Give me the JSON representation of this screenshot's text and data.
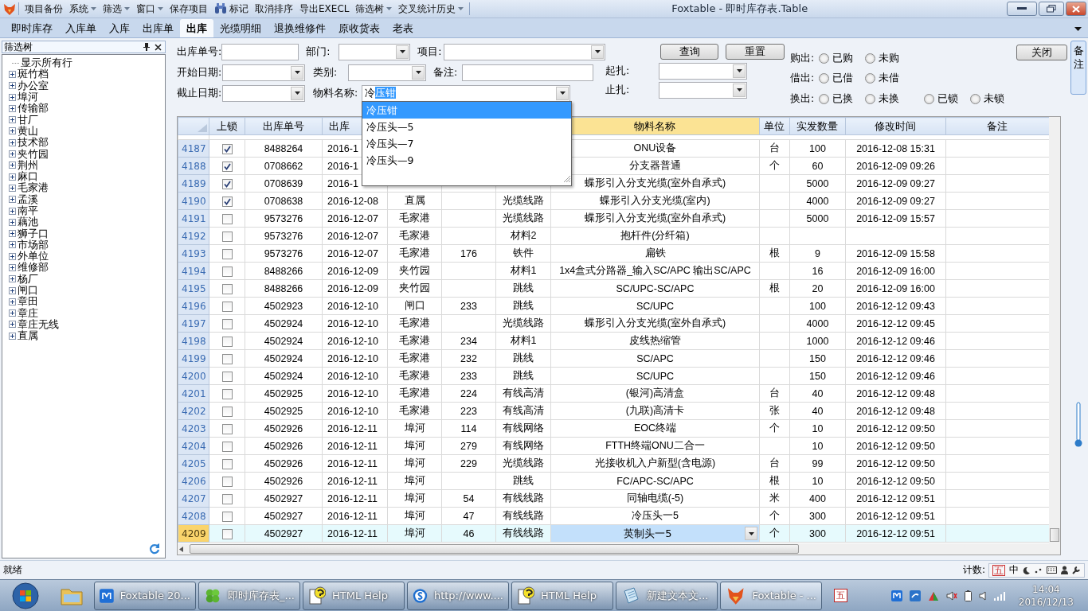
{
  "titlebar": {
    "menu": [
      {
        "label": "项目备份",
        "dropdown": false,
        "has_icon": false
      },
      {
        "label": "系统",
        "dropdown": true,
        "has_icon": false
      },
      {
        "label": "筛选",
        "dropdown": true,
        "has_icon": false
      },
      {
        "label": "窗口",
        "dropdown": true,
        "has_icon": false
      },
      {
        "label": "保存项目",
        "dropdown": false,
        "has_icon": false
      },
      {
        "label": "标记",
        "dropdown": false,
        "has_icon": true
      },
      {
        "label": "取消排序",
        "dropdown": false,
        "has_icon": false
      },
      {
        "label": "导出EXECL",
        "dropdown": false,
        "has_icon": false
      },
      {
        "label": "筛选树",
        "dropdown": true,
        "has_icon": false
      },
      {
        "label": "交叉统计历史",
        "dropdown": true,
        "has_icon": false
      }
    ],
    "title": "Foxtable - 即时库存表.Table"
  },
  "tabs": [
    {
      "label": "即时库存",
      "selected": false
    },
    {
      "label": "入库单",
      "selected": false
    },
    {
      "label": "入库",
      "selected": false
    },
    {
      "label": "出库单",
      "selected": false
    },
    {
      "label": "出库",
      "selected": true
    },
    {
      "label": "光缆明细",
      "selected": false
    },
    {
      "label": "退换维修件",
      "selected": false
    },
    {
      "label": "原收货表",
      "selected": false
    },
    {
      "label": "老表",
      "selected": false
    }
  ],
  "filter_tree": {
    "title": "筛选树",
    "items": [
      {
        "label": "显示所有行",
        "kind": "leaf"
      },
      {
        "label": "斑竹档",
        "kind": "node",
        "expanded": false
      },
      {
        "label": "办公室",
        "kind": "node",
        "expanded": false
      },
      {
        "label": "埠河",
        "kind": "node",
        "expanded": false
      },
      {
        "label": "传输部",
        "kind": "node",
        "expanded": false
      },
      {
        "label": "甘厂",
        "kind": "node",
        "expanded": false
      },
      {
        "label": "黄山",
        "kind": "node",
        "expanded": false
      },
      {
        "label": "技术部",
        "kind": "node",
        "expanded": false
      },
      {
        "label": "夹竹园",
        "kind": "node",
        "expanded": false
      },
      {
        "label": "荆州",
        "kind": "node",
        "expanded": false
      },
      {
        "label": "麻口",
        "kind": "node",
        "expanded": false
      },
      {
        "label": "毛家港",
        "kind": "node",
        "expanded": false
      },
      {
        "label": "孟溪",
        "kind": "node",
        "expanded": false
      },
      {
        "label": "南平",
        "kind": "node",
        "expanded": false
      },
      {
        "label": "藕池",
        "kind": "node",
        "expanded": false
      },
      {
        "label": "狮子口",
        "kind": "node",
        "expanded": false
      },
      {
        "label": "市场部",
        "kind": "node",
        "expanded": false
      },
      {
        "label": "外单位",
        "kind": "node",
        "expanded": false
      },
      {
        "label": "维修部",
        "kind": "node",
        "expanded": false
      },
      {
        "label": "杨厂",
        "kind": "node",
        "expanded": false
      },
      {
        "label": "闸口",
        "kind": "node",
        "expanded": false
      },
      {
        "label": "章田",
        "kind": "node",
        "expanded": false
      },
      {
        "label": "章庄",
        "kind": "node",
        "expanded": false
      },
      {
        "label": "章庄无线",
        "kind": "node",
        "expanded": false
      },
      {
        "label": "直属",
        "kind": "node",
        "expanded": false
      }
    ]
  },
  "filters": {
    "rows": [
      [
        {
          "label": "出库单号:",
          "kind": "text"
        },
        {
          "label": "部门:",
          "kind": "combo"
        },
        {
          "label": "项目:",
          "kind": "combo"
        }
      ],
      [
        {
          "label": "开始日期:",
          "kind": "combo"
        },
        {
          "label": "类别:",
          "kind": "combo"
        },
        {
          "label": "备注:",
          "kind": "text"
        }
      ],
      [
        {
          "label": "截止日期:",
          "kind": "combo"
        },
        {
          "label": "物料名称:",
          "kind": "combo",
          "typed": "冷",
          "selected_text": "压钳"
        }
      ]
    ],
    "range": [
      {
        "label": "起扎:",
        "kind": "combo"
      },
      {
        "label": "止扎:",
        "kind": "combo"
      }
    ],
    "buttons": [
      "查询",
      "重置"
    ],
    "close_button": "关闭",
    "radio_groups": [
      {
        "label": "购出:",
        "options": [
          {
            "label": "已购",
            "selected": false
          },
          {
            "label": "未购",
            "selected": false
          }
        ]
      },
      {
        "label": "借出:",
        "options": [
          {
            "label": "已借",
            "selected": false
          },
          {
            "label": "未借",
            "selected": false
          }
        ]
      },
      {
        "label": "换出:",
        "options": [
          {
            "label": "已换",
            "selected": false
          },
          {
            "label": "未换",
            "selected": false
          }
        ]
      },
      {
        "options": [
          {
            "label": "已锁",
            "selected": false
          },
          {
            "label": "未锁",
            "selected": false
          }
        ]
      }
    ]
  },
  "table": {
    "columns": [
      {
        "label": "上锁",
        "selected": false
      },
      {
        "label": "出库单号",
        "selected": false
      },
      {
        "label": "出库",
        "selected": false
      },
      {},
      {},
      {},
      {
        "label": "物料名称",
        "selected": true
      },
      {
        "label": "单位",
        "selected": false
      },
      {
        "label": "实发数量",
        "selected": false
      },
      {
        "label": "修改时间",
        "selected": false
      },
      {
        "label": "备注",
        "selected": false
      }
    ],
    "rows": [
      {
        "number": "4187",
        "selected": false,
        "locked": true,
        "order_no": "8488264",
        "date": "2016-1",
        "material": "ONU设备",
        "unit": "台",
        "quantity": "100",
        "modified": "2016-12-08 15:31"
      },
      {
        "number": "4188",
        "selected": false,
        "locked": true,
        "order_no": "0708662",
        "date": "2016-1",
        "material": "分支器普通",
        "unit": "个",
        "quantity": "60",
        "modified": "2016-12-09 09:26"
      },
      {
        "number": "4189",
        "selected": false,
        "locked": true,
        "order_no": "0708639",
        "date": "2016-1",
        "material": "蝶形引入分支光缆(室外自承式)",
        "quantity": "5000",
        "modified": "2016-12-09 09:27"
      },
      {
        "number": "4190",
        "selected": false,
        "locked": true,
        "order_no": "0708638",
        "date": "2016-12-08",
        "column_4": "直属",
        "column_6": "光缆线路",
        "material": "蝶形引入分支光缆(室内)",
        "quantity": "4000",
        "modified": "2016-12-09 09:27"
      },
      {
        "number": "4191",
        "selected": false,
        "locked": false,
        "order_no": "9573276",
        "date": "2016-12-07",
        "column_4": "毛家港",
        "column_6": "光缆线路",
        "material": "蝶形引入分支光缆(室外自承式)",
        "quantity": "5000",
        "modified": "2016-12-09 15:57"
      },
      {
        "number": "4192",
        "selected": false,
        "locked": false,
        "order_no": "9573276",
        "date": "2016-12-07",
        "column_4": "毛家港",
        "column_6": "材料2",
        "material": "抱杆件(分纤箱)"
      },
      {
        "number": "4193",
        "selected": false,
        "locked": false,
        "order_no": "9573276",
        "date": "2016-12-07",
        "column_4": "毛家港",
        "column_5": "176",
        "column_6": "铁件",
        "material": "扁铁",
        "unit": "根",
        "quantity": "9",
        "modified": "2016-12-09 15:58"
      },
      {
        "number": "4194",
        "selected": false,
        "locked": false,
        "order_no": "8488266",
        "date": "2016-12-09",
        "column_4": "夹竹园",
        "column_6": "材料1",
        "material": "1x4盒式分路器_输入SC/APC 输出SC/APC",
        "quantity": "16",
        "modified": "2016-12-09 16:00"
      },
      {
        "number": "4195",
        "selected": false,
        "locked": false,
        "order_no": "8488266",
        "date": "2016-12-09",
        "column_4": "夹竹园",
        "column_6": "跳线",
        "material": "SC/UPC-SC/APC",
        "unit": "根",
        "quantity": "20",
        "modified": "2016-12-09 16:00"
      },
      {
        "number": "4196",
        "selected": false,
        "locked": false,
        "order_no": "4502923",
        "date": "2016-12-10",
        "column_4": "闸口",
        "column_5": "233",
        "column_6": "跳线",
        "material": "SC/UPC",
        "quantity": "100",
        "modified": "2016-12-12 09:43"
      },
      {
        "number": "4197",
        "selected": false,
        "locked": false,
        "order_no": "4502924",
        "date": "2016-12-10",
        "column_4": "毛家港",
        "column_6": "光缆线路",
        "material": "蝶形引入分支光缆(室外自承式)",
        "quantity": "4000",
        "modified": "2016-12-12 09:45"
      },
      {
        "number": "4198",
        "selected": false,
        "locked": false,
        "order_no": "4502924",
        "date": "2016-12-10",
        "column_4": "毛家港",
        "column_5": "234",
        "column_6": "材料1",
        "material": "皮线热缩管",
        "quantity": "1000",
        "modified": "2016-12-12 09:46"
      },
      {
        "number": "4199",
        "selected": false,
        "locked": false,
        "order_no": "4502924",
        "date": "2016-12-10",
        "column_4": "毛家港",
        "column_5": "232",
        "column_6": "跳线",
        "material": "SC/APC",
        "quantity": "150",
        "modified": "2016-12-12 09:46"
      },
      {
        "number": "4200",
        "selected": false,
        "locked": false,
        "order_no": "4502924",
        "date": "2016-12-10",
        "column_4": "毛家港",
        "column_5": "233",
        "column_6": "跳线",
        "material": "SC/UPC",
        "quantity": "150",
        "modified": "2016-12-12 09:46"
      },
      {
        "number": "4201",
        "selected": false,
        "locked": false,
        "order_no": "4502925",
        "date": "2016-12-10",
        "column_4": "毛家港",
        "column_5": "224",
        "column_6": "有线高清",
        "material": "(银河)高清盒",
        "unit": "台",
        "quantity": "40",
        "modified": "2016-12-12 09:48"
      },
      {
        "number": "4202",
        "selected": false,
        "locked": false,
        "order_no": "4502925",
        "date": "2016-12-10",
        "column_4": "毛家港",
        "column_5": "223",
        "column_6": "有线高清",
        "material": "(九联)高清卡",
        "unit": "张",
        "quantity": "40",
        "modified": "2016-12-12 09:48"
      },
      {
        "number": "4203",
        "selected": false,
        "locked": false,
        "order_no": "4502926",
        "date": "2016-12-11",
        "column_4": "埠河",
        "column_5": "114",
        "column_6": "有线网络",
        "material": "EOC终端",
        "unit": "个",
        "quantity": "10",
        "modified": "2016-12-12 09:50"
      },
      {
        "number": "4204",
        "selected": false,
        "locked": false,
        "order_no": "4502926",
        "date": "2016-12-11",
        "column_4": "埠河",
        "column_5": "279",
        "column_6": "有线网络",
        "material": "FTTH终端ONU二合一",
        "quantity": "10",
        "modified": "2016-12-12 09:50"
      },
      {
        "number": "4205",
        "selected": false,
        "locked": false,
        "order_no": "4502926",
        "date": "2016-12-11",
        "column_4": "埠河",
        "column_5": "229",
        "column_6": "光缆线路",
        "material": "光接收机入户新型(含电源)",
        "unit": "台",
        "quantity": "99",
        "modified": "2016-12-12 09:50"
      },
      {
        "number": "4206",
        "selected": false,
        "locked": false,
        "order_no": "4502926",
        "date": "2016-12-11",
        "column_4": "埠河",
        "column_6": "跳线",
        "material": "FC/APC-SC/APC",
        "unit": "根",
        "quantity": "10",
        "modified": "2016-12-12 09:50"
      },
      {
        "number": "4207",
        "selected": false,
        "locked": false,
        "order_no": "4502927",
        "date": "2016-12-11",
        "column_4": "埠河",
        "column_5": "54",
        "column_6": "有线线路",
        "material": "同轴电缆(-5)",
        "unit": "米",
        "quantity": "400",
        "modified": "2016-12-12 09:51"
      },
      {
        "number": "4208",
        "selected": false,
        "locked": false,
        "order_no": "4502927",
        "date": "2016-12-11",
        "column_4": "埠河",
        "column_5": "47",
        "column_6": "有线线路",
        "material": "冷压头一5",
        "unit": "个",
        "quantity": "300",
        "modified": "2016-12-12 09:51"
      },
      {
        "number": "4209",
        "selected": true,
        "locked": false,
        "order_no": "4502927",
        "date": "2016-12-11",
        "column_4": "埠河",
        "column_5": "46",
        "column_6": "有线线路",
        "material": "英制头一5",
        "unit": "个",
        "quantity": "300",
        "modified": "2016-12-12 09:51"
      }
    ]
  },
  "dropdown": {
    "items": [
      {
        "label": "冷压钳",
        "selected": true
      },
      {
        "label": "冷压头—5",
        "selected": false
      },
      {
        "label": "冷压头—7",
        "selected": false
      },
      {
        "label": "冷压头—9",
        "selected": false
      }
    ]
  },
  "side_tab": "备注",
  "status_bar": {
    "text": "就绪",
    "count_label": "计数:",
    "ime": [
      "五",
      "中"
    ]
  },
  "taskbar": {
    "items": [
      {
        "label": "Foxtable 20...",
        "kind": "browser",
        "selected": false
      },
      {
        "label": "即时库存表_...",
        "kind": "clover",
        "selected": false
      },
      {
        "label": "HTML Help",
        "kind": "help",
        "selected": false
      },
      {
        "label": "http://www....",
        "kind": "sogou",
        "selected": false
      },
      {
        "label": "HTML Help",
        "kind": "help",
        "selected": false
      },
      {
        "label": "新建文本文...",
        "kind": "notepad",
        "selected": false
      },
      {
        "label": "Foxtable - ...",
        "kind": "fox",
        "selected": true
      }
    ],
    "tray_glyph": "五",
    "time": "14:04",
    "date": "2016/12/13"
  }
}
